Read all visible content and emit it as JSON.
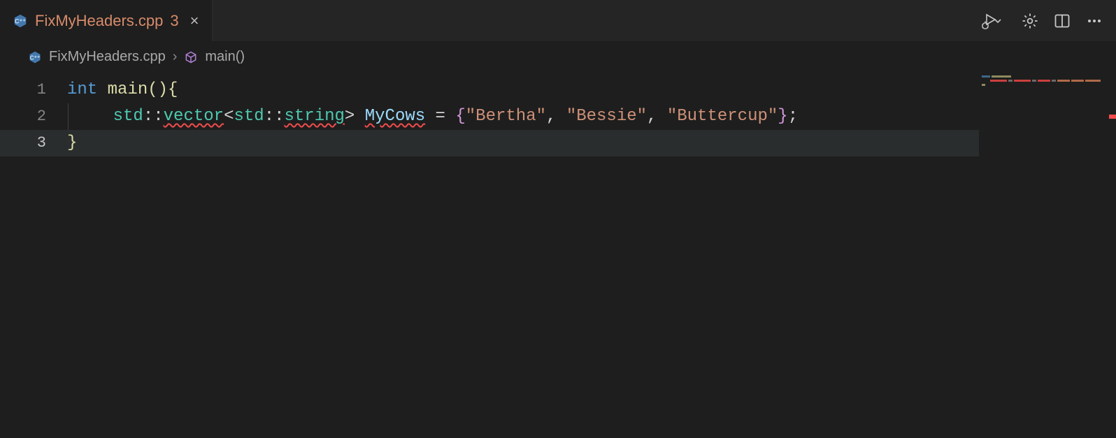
{
  "tab": {
    "filename": "FixMyHeaders.cpp",
    "error_badge": "3",
    "close_glyph": "×"
  },
  "breadcrumb": {
    "filename": "FixMyHeaders.cpp",
    "separator": "›",
    "symbol": "main()"
  },
  "lines": {
    "1": "1",
    "2": "2",
    "3": "3"
  },
  "code": {
    "l1": {
      "keyword": "int ",
      "func": "main",
      "paren_open": "(",
      "paren_close": ")",
      "brace_open": "{"
    },
    "l2": {
      "indent": "    ",
      "ns1": "std",
      "sep1": "::",
      "vec": "vector",
      "lt": "<",
      "ns2": "std",
      "sep2": "::",
      "str": "string",
      "gt": "> ",
      "ident": "MyCows",
      "eq": " = ",
      "brace_open": "{",
      "s1": "\"Bertha\"",
      "c1": ", ",
      "s2": "\"Bessie\"",
      "c2": ", ",
      "s3": "\"Buttercup\"",
      "brace_close": "}",
      "semi": ";"
    },
    "l3": {
      "brace_close": "}"
    }
  },
  "icons": {
    "run": "run-debug-icon",
    "chevron": "chevron-down-icon",
    "settings": "gear-icon",
    "split": "split-editor-icon",
    "more": "ellipsis-icon",
    "cube": "symbol-cube-icon"
  }
}
